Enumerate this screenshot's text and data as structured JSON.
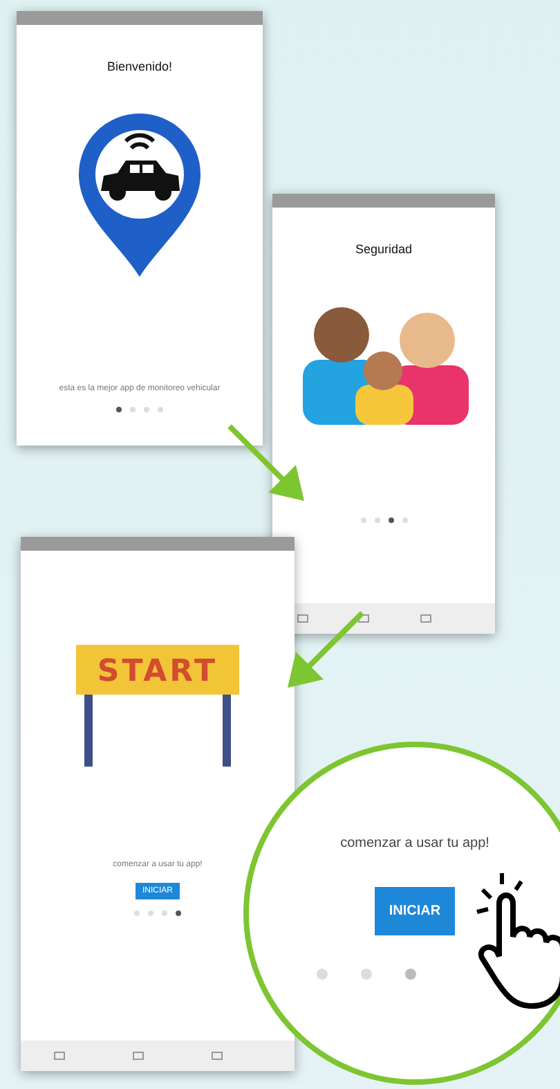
{
  "screens": [
    {
      "title": "Bienvenido!",
      "kind": "pin",
      "caption": "esta es la mejor app de monitoreo vehicular",
      "dots": [
        {
          "selected": true
        },
        {
          "selected": false
        },
        {
          "selected": false
        },
        {
          "selected": false
        }
      ],
      "nav_bar": false
    },
    {
      "title": "Seguridad",
      "kind": "family",
      "dots": [
        {
          "selected": false
        },
        {
          "selected": false
        },
        {
          "selected": true
        },
        {
          "selected": false
        }
      ],
      "nav_bar": true
    },
    {
      "kind": "banner",
      "banner_text": "START",
      "caption": "comenzar a usar tu app!",
      "button": "INICIAR",
      "dots": [
        {
          "selected": false
        },
        {
          "selected": false
        },
        {
          "selected": false
        },
        {
          "selected": true
        }
      ],
      "nav_bar": true
    }
  ],
  "zoom_callout": {
    "caption": "comenzar a usar tu app!",
    "button": "INICIAR",
    "dots": [
      {
        "selected": false
      },
      {
        "selected": false
      },
      {
        "selected": true
      }
    ]
  }
}
